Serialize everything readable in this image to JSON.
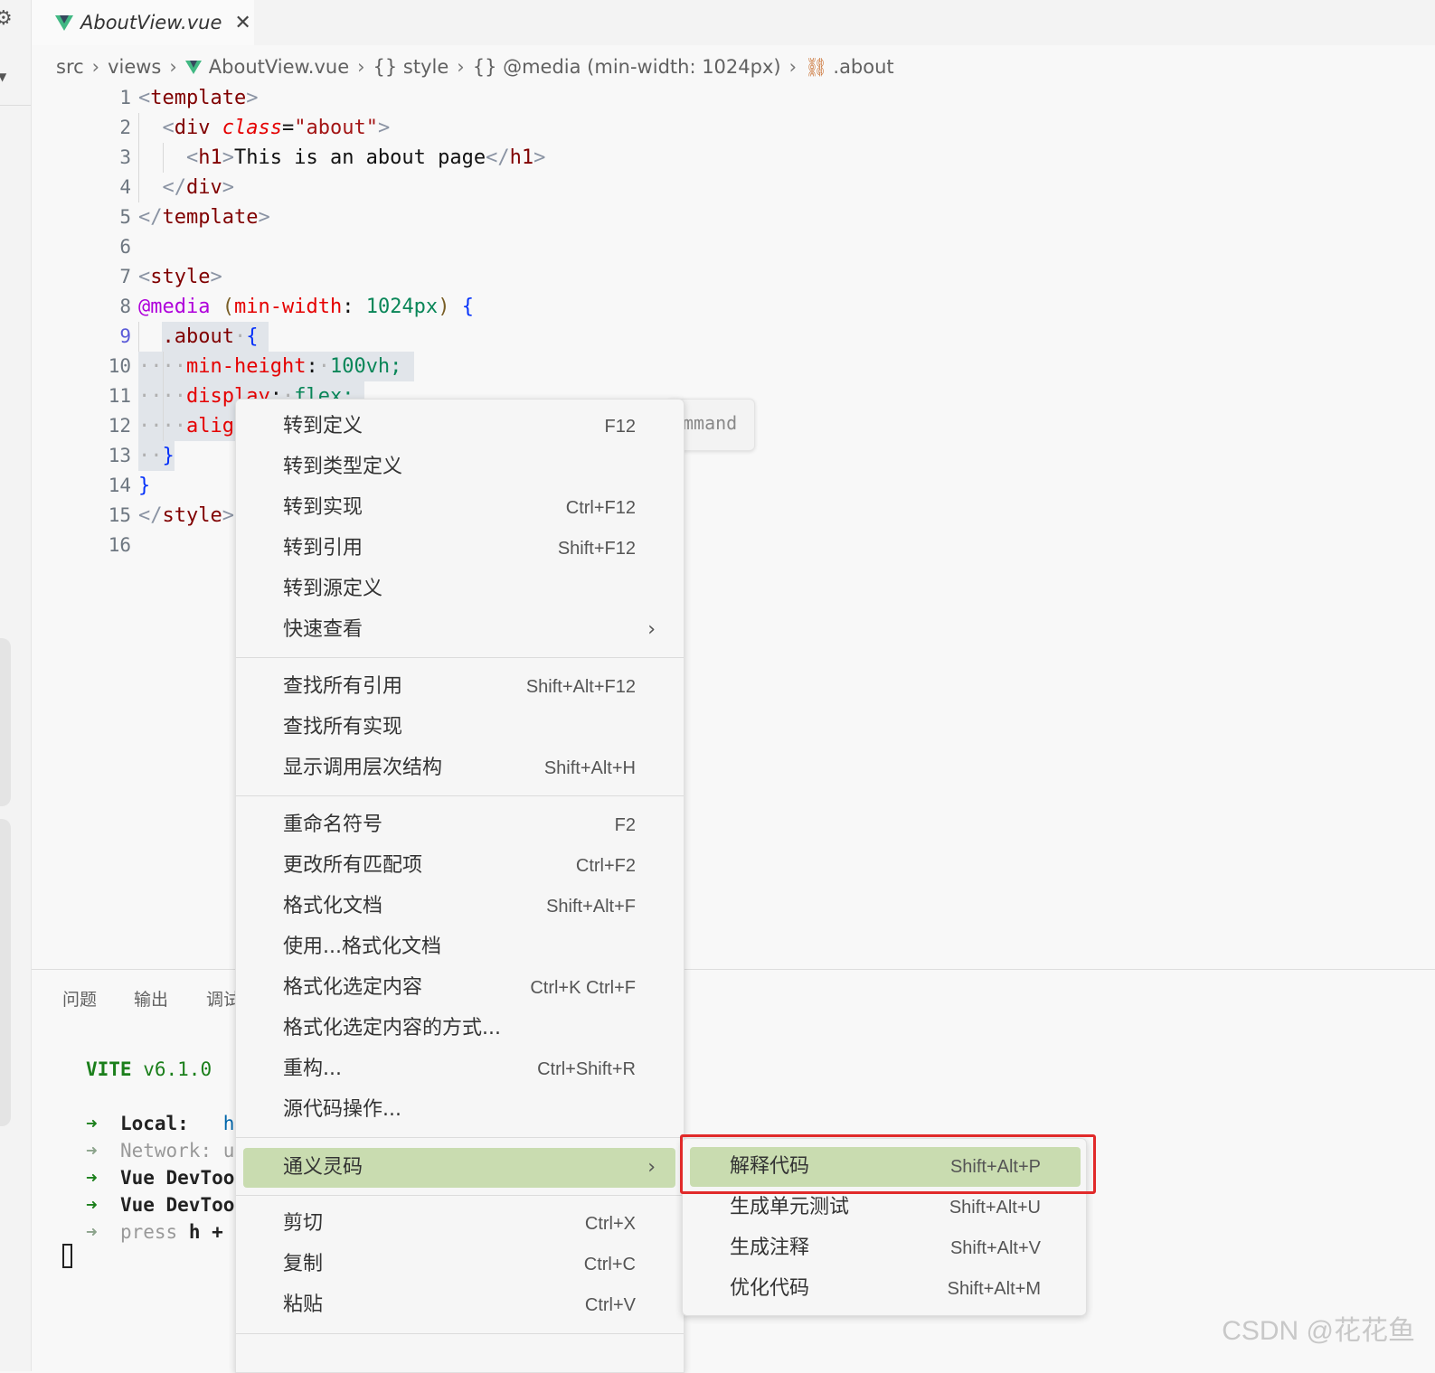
{
  "tab": {
    "file": "AboutView.vue",
    "close": "✕"
  },
  "breadcrumb": {
    "src": "src",
    "views": "views",
    "file": "AboutView.vue",
    "style": "{} style",
    "media": "{} @media (min-width: 1024px)",
    "about": ".about"
  },
  "lines": {
    "l1": "1",
    "l2": "2",
    "l3": "3",
    "l4": "4",
    "l5": "5",
    "l6": "6",
    "l7": "7",
    "l8": "8",
    "l9": "9",
    "l10": "10",
    "l11": "11",
    "l12": "12",
    "l13": "13",
    "l14": "14",
    "l15": "15",
    "l16": "16"
  },
  "code": {
    "template": "template",
    "div": "div",
    "class_attr": "class",
    "class_val": "\"about\"",
    "h1": "h1",
    "h1_text": "This is an about page",
    "style": "style",
    "media": "@media",
    "minw": "min-width",
    "px": "1024px",
    "about_sel": ".about",
    "minh": "min-height",
    "vh": "100vh;",
    "display": "display",
    "flex": "flex;",
    "align": "alig"
  },
  "panel": {
    "tab_problems": "问题",
    "tab_output": "输出",
    "tab_debug": "调试"
  },
  "terminal": {
    "vite": "VITE",
    "version": "v6.1.0",
    "local": "Local:",
    "local_val": "h",
    "network": "Network:",
    "network_val": "u",
    "devtools1": "Vue DevToo",
    "devtools2": "Vue DevToo",
    "press": "press",
    "press_h": "h +"
  },
  "hint": "mmand",
  "menu": {
    "go_def": {
      "label": "转到定义",
      "key": "F12"
    },
    "go_type_def": {
      "label": "转到类型定义",
      "key": ""
    },
    "go_impl": {
      "label": "转到实现",
      "key": "Ctrl+F12"
    },
    "go_refs": {
      "label": "转到引用",
      "key": "Shift+F12"
    },
    "go_src_def": {
      "label": "转到源定义",
      "key": ""
    },
    "peek": {
      "label": "快速查看",
      "key": ""
    },
    "find_refs": {
      "label": "查找所有引用",
      "key": "Shift+Alt+F12"
    },
    "find_impls": {
      "label": "查找所有实现",
      "key": ""
    },
    "call_hierarchy": {
      "label": "显示调用层次结构",
      "key": "Shift+Alt+H"
    },
    "rename": {
      "label": "重命名符号",
      "key": "F2"
    },
    "change_all": {
      "label": "更改所有匹配项",
      "key": "Ctrl+F2"
    },
    "format_doc": {
      "label": "格式化文档",
      "key": "Shift+Alt+F"
    },
    "format_with": {
      "label": "使用...格式化文档",
      "key": ""
    },
    "format_sel": {
      "label": "格式化选定内容",
      "key": "Ctrl+K Ctrl+F"
    },
    "format_sel_with": {
      "label": "格式化选定内容的方式...",
      "key": ""
    },
    "refactor": {
      "label": "重构...",
      "key": "Ctrl+Shift+R"
    },
    "source_action": {
      "label": "源代码操作...",
      "key": ""
    },
    "tongyi": {
      "label": "通义灵码",
      "key": ""
    },
    "cut": {
      "label": "剪切",
      "key": "Ctrl+X"
    },
    "copy": {
      "label": "复制",
      "key": "Ctrl+C"
    },
    "paste": {
      "label": "粘贴",
      "key": "Ctrl+V"
    }
  },
  "submenu": {
    "explain": {
      "label": "解释代码",
      "key": "Shift+Alt+P"
    },
    "unit_test": {
      "label": "生成单元测试",
      "key": "Shift+Alt+U"
    },
    "comment": {
      "label": "生成注释",
      "key": "Shift+Alt+V"
    },
    "optimize": {
      "label": "优化代码",
      "key": "Shift+Alt+M"
    }
  },
  "watermark": "CSDN @花花鱼",
  "colors": {
    "selection": "#c9dcb0",
    "highlight_box": "#e12a2a",
    "vue_green": "#41b883"
  }
}
